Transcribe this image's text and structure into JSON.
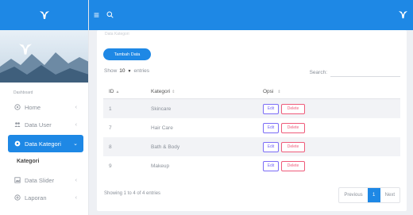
{
  "topbar": {
    "menu_icon": "hamburger-icon",
    "search_icon": "search-icon"
  },
  "sidebar": {
    "section_label": "Dashboard",
    "items": [
      {
        "label": "Home",
        "icon": "home-icon"
      },
      {
        "label": "Data User",
        "icon": "users-icon"
      },
      {
        "label": "Data Kategori",
        "icon": "tag-icon",
        "active": true
      },
      {
        "label": "Data Slider",
        "icon": "image-icon"
      },
      {
        "label": "Laporan",
        "icon": "report-icon"
      }
    ],
    "sub_item": "Kategori"
  },
  "card": {
    "faded_text": "Data Kategori",
    "add_button": "Tambah Data",
    "show_prefix": "Show",
    "show_value": "10",
    "show_suffix": "entries",
    "search_label": "Search:"
  },
  "table": {
    "headers": [
      {
        "label": "ID",
        "sort": "▲"
      },
      {
        "label": "Kategori",
        "sort": "⇕"
      },
      {
        "label": "Opsi",
        "sort": "⇕"
      }
    ],
    "rows": [
      {
        "id": "1",
        "kategori": "Skincare",
        "edit": "Edit",
        "delete": "Delete"
      },
      {
        "id": "7",
        "kategori": "Hair Care",
        "edit": "Edit",
        "delete": "Delete"
      },
      {
        "id": "8",
        "kategori": "Bath & Body",
        "edit": "Edit",
        "delete": "Delete"
      },
      {
        "id": "9",
        "kategori": "Makeup",
        "edit": "Edit",
        "delete": "Delete"
      }
    ]
  },
  "footer": {
    "info": "Showing 1 to 4 of 4 entries",
    "previous": "Previous",
    "current_page": "1",
    "next": "Next"
  },
  "colors": {
    "primary": "#1e88e5",
    "edit": "#7b6cf6",
    "delete": "#ef5b7a"
  }
}
